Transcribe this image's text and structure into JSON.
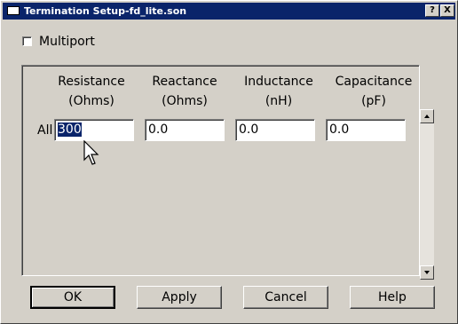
{
  "window": {
    "title": "Termination Setup-fd_lite.son",
    "help_button": "?",
    "close_button": "X"
  },
  "multiport": {
    "label": "Multiport",
    "checked": false
  },
  "table": {
    "columns": [
      {
        "name": "Resistance",
        "unit": "(Ohms)"
      },
      {
        "name": "Reactance",
        "unit": "(Ohms)"
      },
      {
        "name": "Inductance",
        "unit": "(nH)"
      },
      {
        "name": "Capacitance",
        "unit": "(pF)"
      }
    ],
    "rows": [
      {
        "label": "All",
        "values": [
          "300",
          "0.0",
          "0.0",
          "0.0"
        ]
      }
    ]
  },
  "buttons": {
    "ok": "OK",
    "apply": "Apply",
    "cancel": "Cancel",
    "help": "Help"
  },
  "colors": {
    "title_bar": "#0a246a",
    "face": "#d4d0c8",
    "selection": "#0a246a"
  }
}
